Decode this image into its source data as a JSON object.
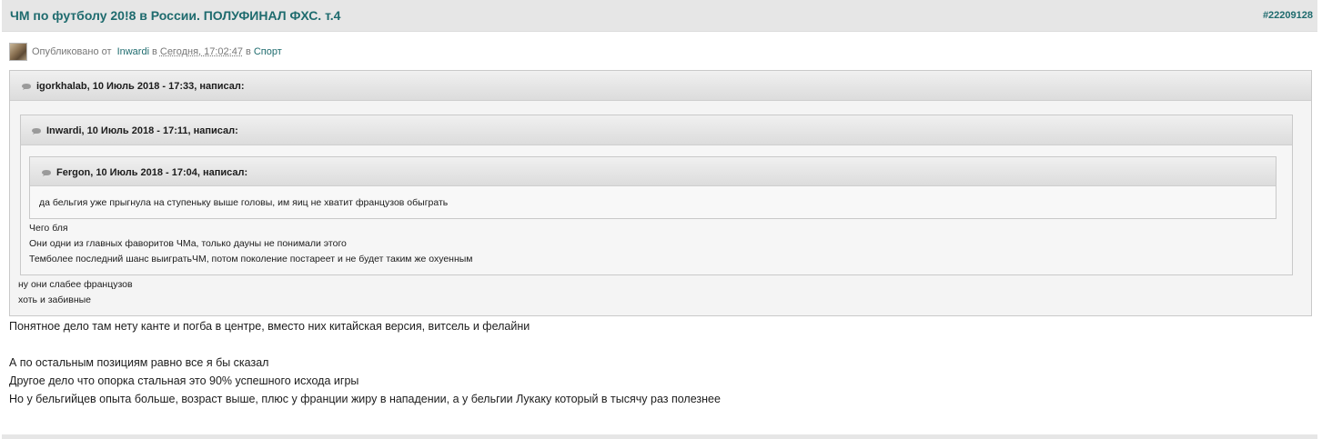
{
  "post": {
    "title": "ЧМ по футболу 20!8 в России. ПОЛУФИНАЛ ФХС. т.4",
    "id": "#22209128"
  },
  "meta": {
    "published_label": "Опубликовано от",
    "author": "Inwardi",
    "in_word": "в",
    "date": "Сегодня, 17:02:47",
    "in_word2": "в",
    "category": "Спорт"
  },
  "quotes": {
    "outer": {
      "header": "igorkhalab, 10 Июль 2018 - 17:33, написал:",
      "lines": [
        "ну они слабее французов",
        "хоть и забивные"
      ]
    },
    "middle": {
      "header": "Inwardi, 10 Июль 2018 - 17:11, написал:",
      "lines": [
        "Чего бля",
        "Они одни из главных фаворитов ЧМа, только дауны не понимали этого",
        "Темболее последний шанс выигратьЧМ, потом поколение постареет и не будет таким же охуенным"
      ]
    },
    "inner": {
      "header": "Fergon, 10 Июль 2018 - 17:04, написал:",
      "lines": [
        "да бельгия уже прыгнула на ступеньку выше головы, им яиц не хватит французов обыграть"
      ]
    }
  },
  "body": {
    "lines": [
      "Понятное дело там нету канте и погба в центре, вместо них китайская версия, витсель и фелайни",
      "А по остальным позициям равно все я бы сказал",
      "Другое дело что опорка стальная это 90% успешного исхода игры",
      "Но у бельгийцев опыта больше, возраст выше, плюс у франции жиру в нападении, а у бельгии Лукаку который в тысячу раз полезнее"
    ]
  },
  "icons": {
    "quote": "quote-bubble-icon",
    "avatar": "user-avatar"
  },
  "colors": {
    "accent": "#1e6b6e",
    "header_bg": "#e6e6e6",
    "quote_border": "#c9c9c9"
  }
}
